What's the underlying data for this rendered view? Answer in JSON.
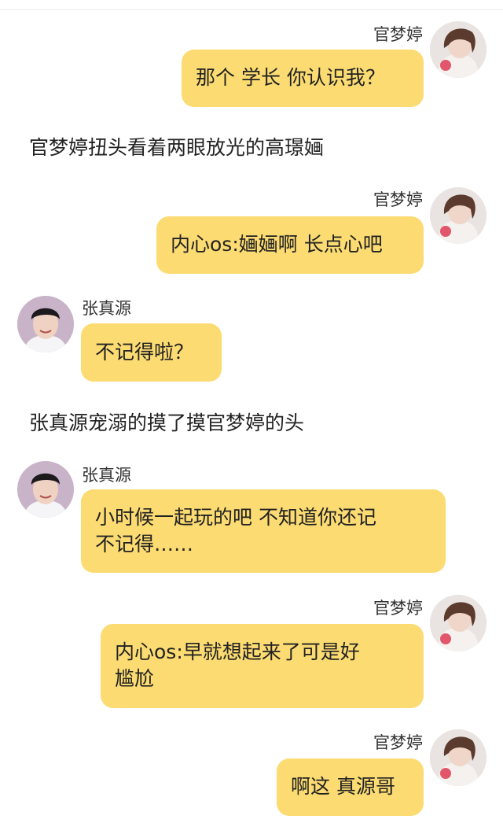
{
  "messages": [
    {
      "type": "bubble",
      "side": "right",
      "sender": "官梦婷",
      "avatar": "girl-avatar",
      "text": "那个 学长 你认识我？"
    },
    {
      "type": "narration",
      "text": "官梦婷扭头看着两眼放光的高璟婳"
    },
    {
      "type": "bubble",
      "side": "right",
      "sender": "官梦婷",
      "avatar": "girl-avatar",
      "text": "内心os:婳婳啊 长点心吧"
    },
    {
      "type": "bubble",
      "side": "left",
      "sender": "张真源",
      "avatar": "boy-avatar",
      "text": "不记得啦？"
    },
    {
      "type": "narration",
      "text": "张真源宠溺的摸了摸官梦婷的头"
    },
    {
      "type": "bubble",
      "side": "left",
      "sender": "张真源",
      "avatar": "boy-avatar",
      "line1": "小时候一起玩的吧 不知道你还记",
      "line2": "不记得……"
    },
    {
      "type": "bubble",
      "side": "right",
      "sender": "官梦婷",
      "avatar": "girl-avatar",
      "line1": "内心os:早就想起来了可是好",
      "line2": "尴尬"
    },
    {
      "type": "bubble",
      "side": "right",
      "sender": "官梦婷",
      "avatar": "girl-avatar",
      "text": "啊这 真源哥"
    }
  ],
  "colors": {
    "bubble": "#fbdb72",
    "background": "#ffffff",
    "text": "#222222"
  }
}
